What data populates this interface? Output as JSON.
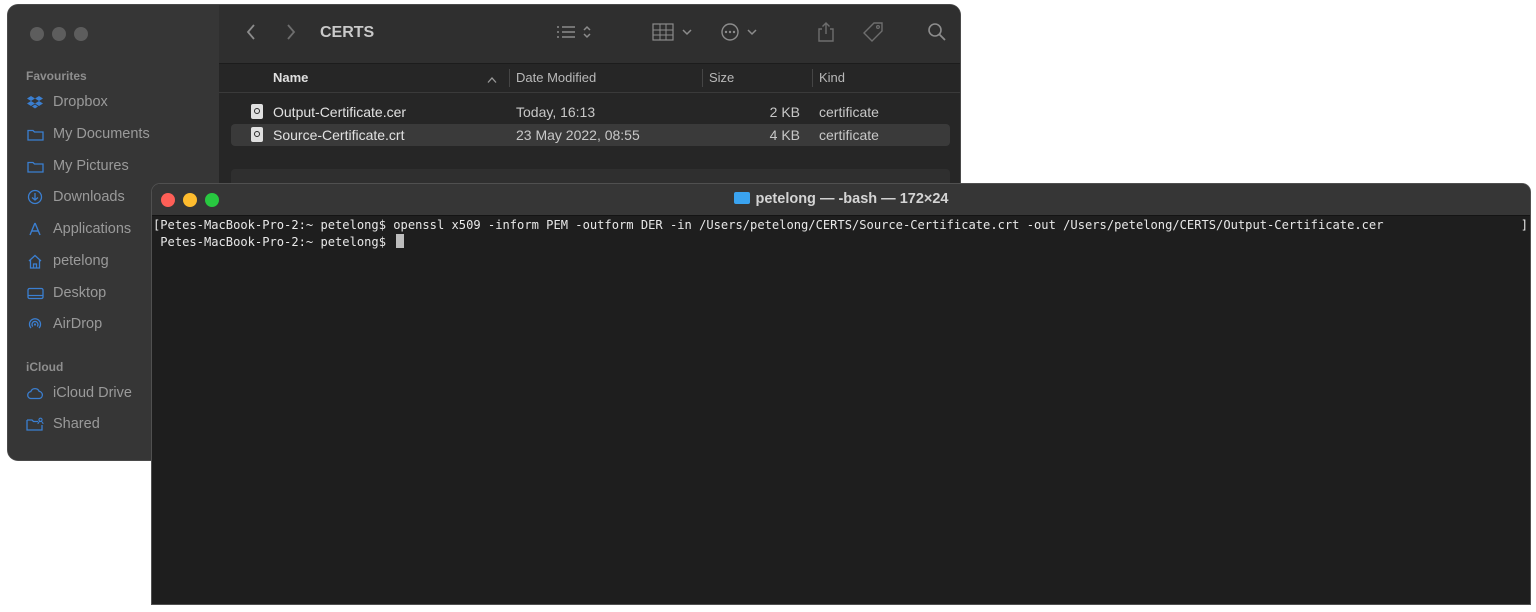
{
  "finder": {
    "folder_title": "CERTS",
    "sidebar": {
      "favourites_header": "Favourites",
      "favourites": [
        {
          "label": "Dropbox",
          "icon": "dropbox-icon"
        },
        {
          "label": "My Documents",
          "icon": "folder-icon"
        },
        {
          "label": "My Pictures",
          "icon": "folder-icon"
        },
        {
          "label": "Downloads",
          "icon": "download-icon"
        },
        {
          "label": "Applications",
          "icon": "applications-icon"
        },
        {
          "label": "petelong",
          "icon": "home-icon"
        },
        {
          "label": "Desktop",
          "icon": "desktop-icon"
        },
        {
          "label": "AirDrop",
          "icon": "airdrop-icon"
        }
      ],
      "icloud_header": "iCloud",
      "icloud": [
        {
          "label": "iCloud Drive",
          "icon": "cloud-icon"
        },
        {
          "label": "Shared",
          "icon": "shared-folder-icon"
        }
      ]
    },
    "columns": {
      "name": "Name",
      "date": "Date Modified",
      "size": "Size",
      "kind": "Kind"
    },
    "files": [
      {
        "name": "Output-Certificate.cer",
        "date": "Today, 16:13",
        "size": "2 KB",
        "kind": "certificate"
      },
      {
        "name": "Source-Certificate.crt",
        "date": "23 May 2022, 08:55",
        "size": "4 KB",
        "kind": "certificate"
      }
    ],
    "accent_color": "#3aa3f0"
  },
  "terminal": {
    "title": "petelong — -bash — 172×24",
    "lines": [
      "[Petes-MacBook-Pro-2:~ petelong$ openssl x509 -inform PEM -outform DER -in /Users/petelong/CERTS/Source-Certificate.crt -out /Users/petelong/CERTS/Output-Certificate.cer",
      " Petes-MacBook-Pro-2:~ petelong$ "
    ],
    "trailing_bracket": "]",
    "traffic_lights": {
      "close": "#fe5f57",
      "minimize": "#febc2e",
      "zoom": "#28c840"
    }
  }
}
